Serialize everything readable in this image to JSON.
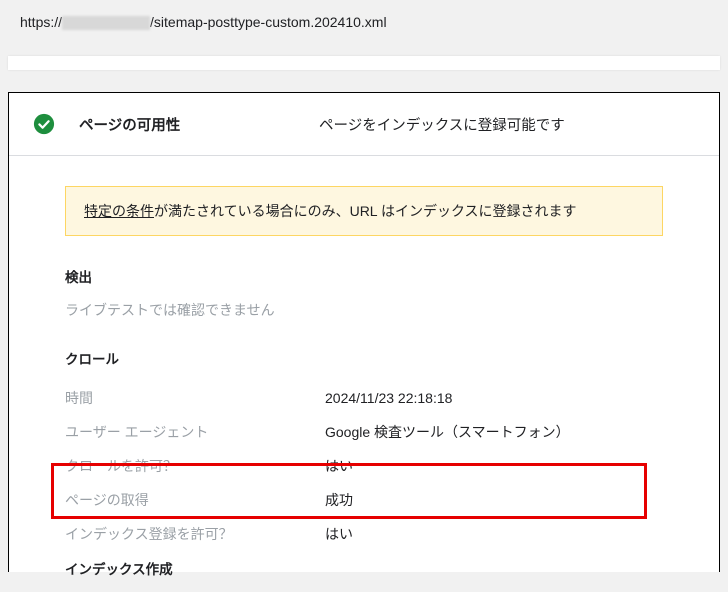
{
  "url": {
    "prefix": "https://",
    "suffix": "/sitemap-posttype-custom.202410.xml"
  },
  "header": {
    "title": "ページの可用性",
    "status": "ページをインデックスに登録可能です"
  },
  "notice": {
    "underlined": "特定の条件",
    "rest": "が満たされている場合にのみ、URL はインデックスに登録されます"
  },
  "sections": {
    "discovery": {
      "title": "検出",
      "message": "ライブテストでは確認できません"
    },
    "crawl": {
      "title": "クロール",
      "rows": [
        {
          "key": "時間",
          "value": "2024/11/23 22:18:18"
        },
        {
          "key": "ユーザー エージェント",
          "value": "Google 検査ツール（スマートフォン）"
        },
        {
          "key": "クロールを許可？",
          "value": "はい"
        },
        {
          "key": "ページの取得",
          "value": "成功"
        },
        {
          "key": "インデックス登録を許可？",
          "value": "はい"
        }
      ]
    },
    "indexing": {
      "title": "インデックス作成"
    }
  }
}
